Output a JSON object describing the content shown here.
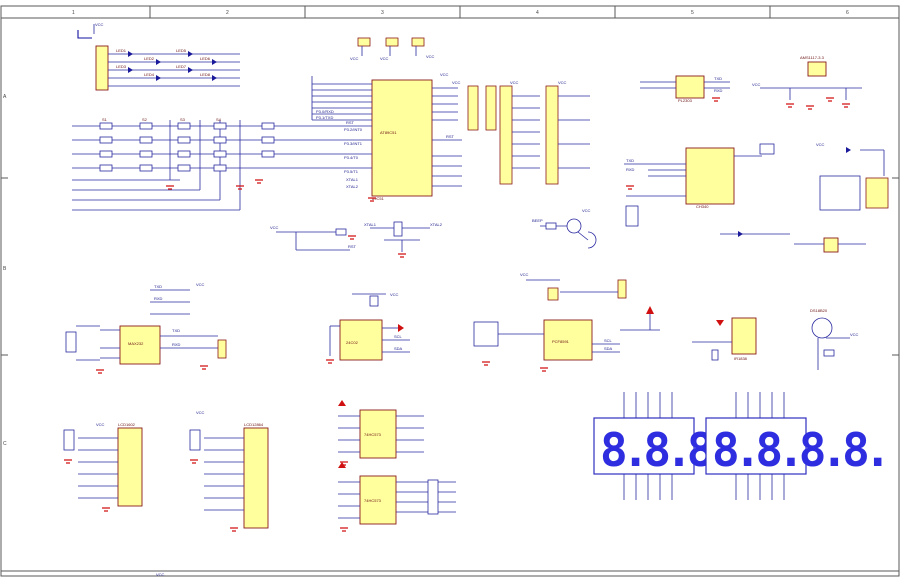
{
  "frame": {
    "columns": [
      "1",
      "2",
      "3",
      "4",
      "5",
      "6"
    ],
    "rows": [
      "A",
      "B",
      "C"
    ]
  },
  "power_label": "VCC",
  "chips": {
    "mcu": "AT89C51",
    "mcu_sub": "89C51",
    "serial": "MAX232",
    "rtc": "DS1302",
    "eeprom": "24C02",
    "adc": "PCF8591",
    "lcd1602": "LCD1602",
    "lcd12864": "LCD12864",
    "latch_a": "74HC573",
    "latch_b": "74HC573",
    "usb": "CH340",
    "ir": "IR1838",
    "regulator": "AMS1117-3.3",
    "temp": "DS18B20",
    "stepper": "ULN2003",
    "uart_bridge": "PL2303"
  },
  "nets": {
    "rst": "RST",
    "xtal1": "XTAL1",
    "xtal2": "XTAL2",
    "txd": "TXD",
    "rxd": "RXD",
    "beep": "BEEP",
    "sda": "SDA",
    "scl": "SCL",
    "p_rows": [
      "P3.0/RXD",
      "P3.1/TXD",
      "P3.2/INT0",
      "P3.3/INT1",
      "P3.4/T0",
      "P3.5/T1",
      "P3.6/WR",
      "P3.7/RD"
    ],
    "keys": [
      "S1",
      "S2",
      "S3",
      "S4",
      "S5",
      "S6",
      "S7",
      "S8",
      "S9",
      "S10",
      "S11",
      "S12",
      "S13",
      "S14",
      "S15",
      "S16"
    ],
    "led_labels": [
      "LED1",
      "LED2",
      "LED3",
      "LED4",
      "LED5",
      "LED6",
      "LED7",
      "LED8"
    ]
  },
  "display": {
    "left_digits": "8.8.8.8.",
    "right_digits": "8.8.8.8."
  },
  "colors": {
    "chip_fill": "#ffff9e",
    "chip_border": "#8a1a1a",
    "wire": "#2a2aa0",
    "ground": "#d01010",
    "segment": "#2e2ee0"
  }
}
